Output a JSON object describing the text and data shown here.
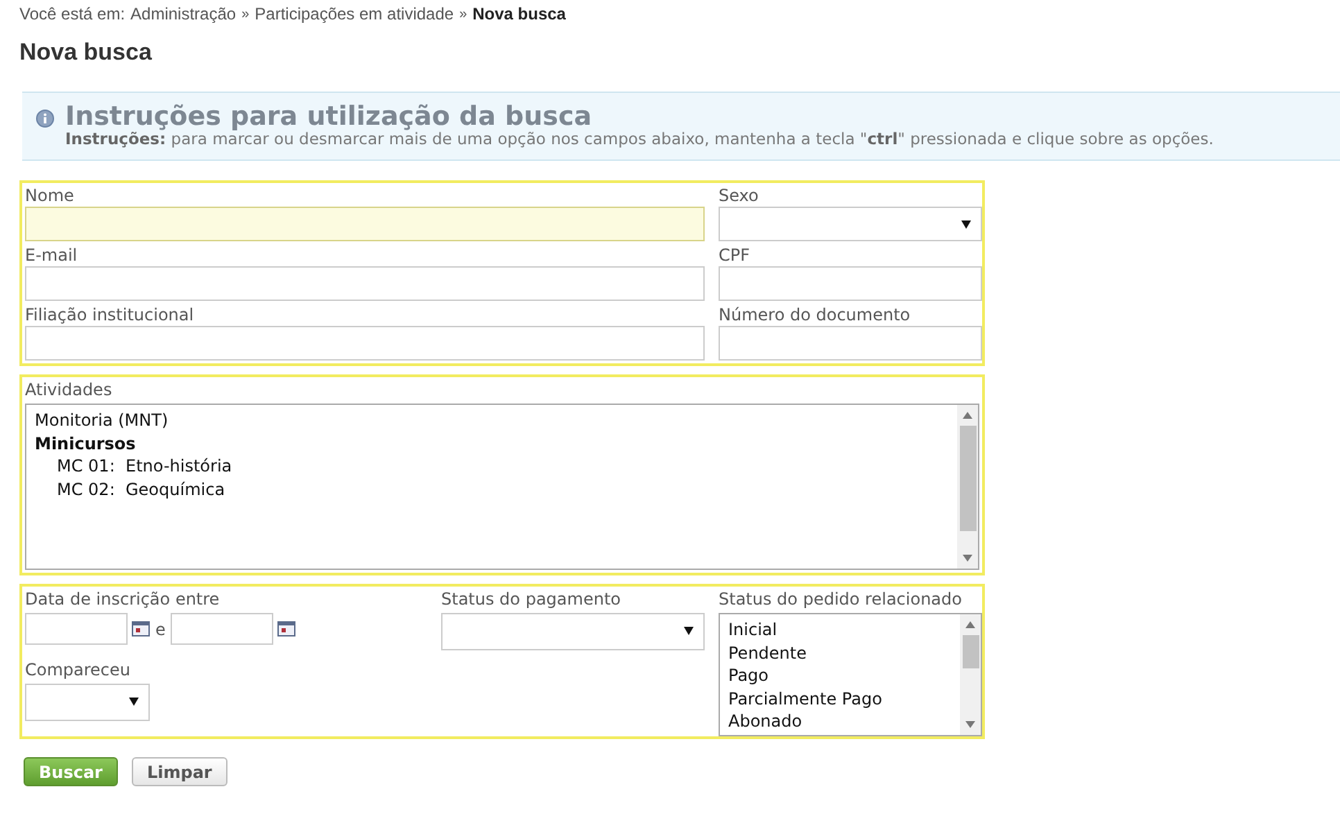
{
  "breadcrumb": {
    "prefix": "Você está em:",
    "items": [
      {
        "label": "Administração",
        "current": false
      },
      {
        "label": "Participações em atividade",
        "current": false
      },
      {
        "label": "Nova busca",
        "current": true
      }
    ],
    "separator": "»"
  },
  "title": "Nova busca",
  "instructions": {
    "heading": "Instruções para utilização da busca",
    "text": "**Instruções:** para marcar ou desmarcar mais de uma opção nos campos abaixo, mantenha a tecla \"**ctrl**\" pressionada e clique sobre as opções."
  },
  "personal_fields": [
    {
      "label": "Nome",
      "kind": "text",
      "focused": true
    },
    {
      "label": "Sexo",
      "kind": "select",
      "focused": false
    },
    {
      "label": "E-mail",
      "kind": "text",
      "focused": false
    },
    {
      "label": "CPF",
      "kind": "text",
      "focused": false
    },
    {
      "label": "Filiação institucional",
      "kind": "text",
      "focused": false
    },
    {
      "label": "Número do documento",
      "kind": "text",
      "focused": false
    }
  ],
  "activities": {
    "label": "Atividades",
    "options": [
      {
        "label": "Monitoria (MNT)",
        "kind": "option"
      },
      {
        "label": "Minicursos",
        "kind": "group",
        "children": [
          {
            "label": "MC 01:  Etno-história"
          },
          {
            "label": "MC 02:  Geoquímica"
          }
        ]
      }
    ]
  },
  "date_range": {
    "label": "Data de inscrição entre",
    "joiner": "e"
  },
  "attended": {
    "label": "Compareceu"
  },
  "payment_status": {
    "label": "Status do pagamento"
  },
  "order_status": {
    "label": "Status do pedido relacionado",
    "options": [
      "Inicial",
      "Pendente",
      "Pago",
      "Parcialmente Pago",
      "Abonado"
    ]
  },
  "buttons": [
    {
      "label": "Buscar",
      "kind": "primary"
    },
    {
      "label": "Limpar",
      "kind": "secondary"
    }
  ]
}
